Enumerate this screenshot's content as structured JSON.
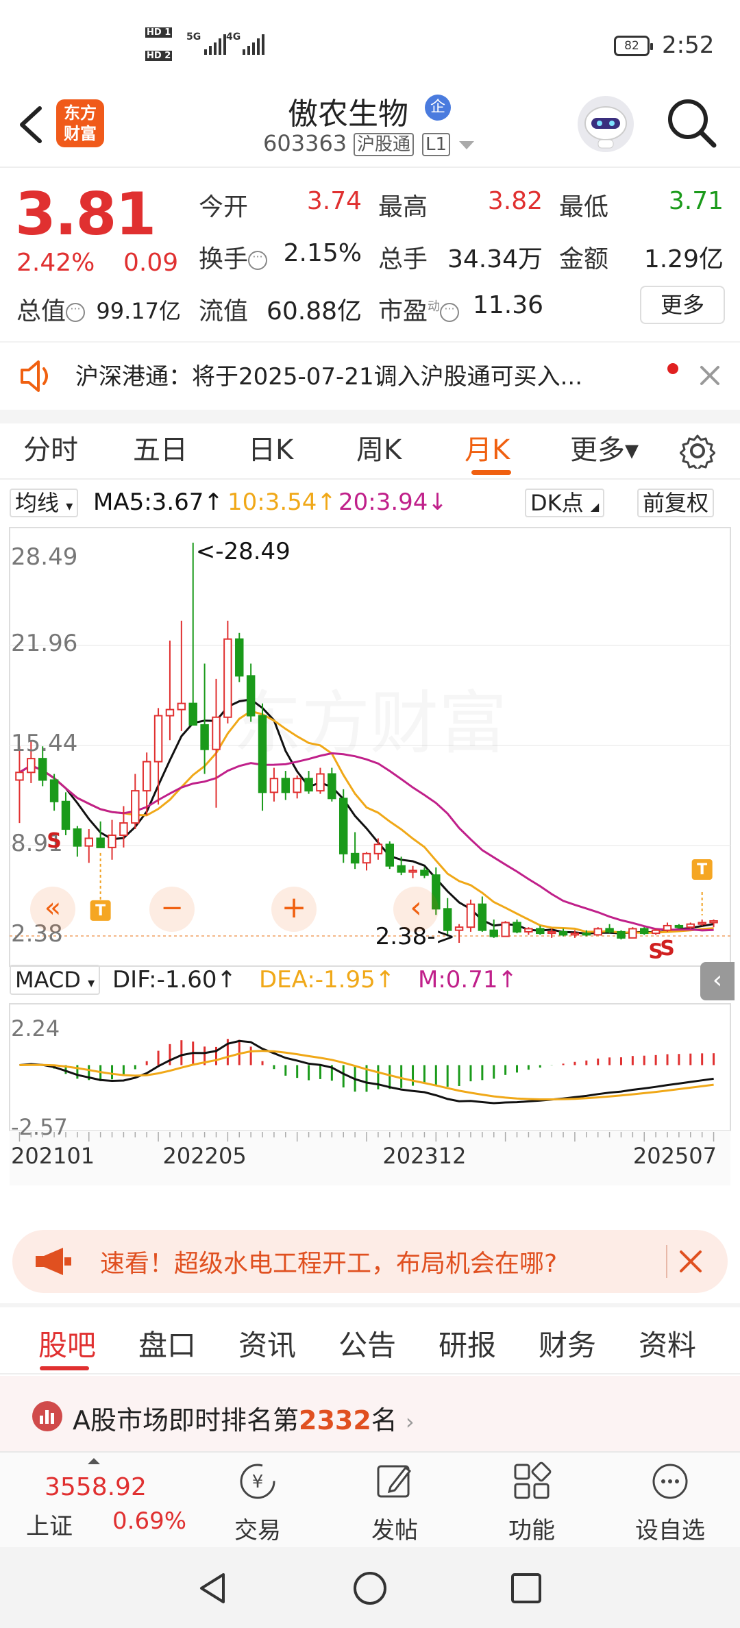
{
  "status_bar": {
    "sim1": "HD 1",
    "sim2": "HD 2",
    "net1": "5G",
    "net2": "4G",
    "battery": "82",
    "time": "2:52"
  },
  "header": {
    "logo_line1": "东方",
    "logo_line2": "财富",
    "stock_name": "傲农生物",
    "badge": "企",
    "code": "603363",
    "tag_connect": "沪股通",
    "tag_level": "L1"
  },
  "quote": {
    "price": "3.81",
    "change_pct": "2.42%",
    "change_val": "0.09",
    "open_label": "今开",
    "open": "3.74",
    "high_label": "最高",
    "high": "3.82",
    "low_label": "最低",
    "low": "3.71",
    "turnover_label": "换手",
    "turnover": "2.15%",
    "volume_label": "总手",
    "volume": "34.34万",
    "amount_label": "金额",
    "amount": "1.29亿",
    "mktcap_label": "总值",
    "mktcap": "99.17亿",
    "float_label": "流值",
    "float": "60.88亿",
    "pe_label": "市盈",
    "pe_sup": "动",
    "pe": "11.36",
    "more": "更多"
  },
  "notice": {
    "text": "沪深港通：将于2025-07-21调入沪股通可买入..."
  },
  "tabs": [
    "分时",
    "五日",
    "日K",
    "周K",
    "月K",
    "更多▾"
  ],
  "active_tab": "月K",
  "indicator_bar": {
    "ma_select": "均线",
    "ma5": "MA5:3.67↑",
    "ma10": "10:3.54↑",
    "ma20": "20:3.94↓",
    "dk": "DK点",
    "adjust": "前复权"
  },
  "colors": {
    "up": "#e03030",
    "down": "#1a9a1a",
    "ma5": "#111111",
    "ma10": "#f0a818",
    "ma20": "#c0208a",
    "accent": "#f06010"
  },
  "chart_data": {
    "type": "candlestick",
    "period": "monthly",
    "y_ticks": [
      "28.49",
      "21.96",
      "15.44",
      "8.91",
      "2.38"
    ],
    "ylim": [
      2.38,
      28.49
    ],
    "max_label": "<-28.49",
    "min_label": "2.38->",
    "x_ticks": [
      "202101",
      "202205",
      "202312",
      "202507"
    ],
    "candles": [
      [
        13.0,
        15.2,
        10.2,
        13.5
      ],
      [
        13.5,
        15.6,
        12.8,
        14.4
      ],
      [
        14.4,
        15.2,
        12.6,
        13.0
      ],
      [
        13.0,
        13.4,
        11.0,
        11.6
      ],
      [
        11.6,
        12.2,
        9.4,
        9.8
      ],
      [
        9.8,
        10.0,
        8.0,
        8.7
      ],
      [
        8.7,
        9.8,
        7.6,
        9.2
      ],
      [
        9.2,
        10.3,
        8.6,
        8.6
      ],
      [
        8.6,
        10.4,
        7.8,
        9.4
      ],
      [
        9.4,
        11.3,
        8.6,
        10.2
      ],
      [
        10.2,
        13.4,
        9.8,
        12.3
      ],
      [
        12.3,
        14.8,
        10.7,
        14.2
      ],
      [
        14.2,
        17.7,
        11.4,
        17.2
      ],
      [
        17.2,
        22.1,
        15.6,
        17.6
      ],
      [
        17.6,
        23.4,
        16.2,
        18.0
      ],
      [
        18.0,
        28.49,
        16.6,
        16.6
      ],
      [
        16.6,
        20.6,
        13.4,
        15.0
      ],
      [
        15.0,
        19.6,
        11.2,
        17.1
      ],
      [
        17.1,
        23.4,
        16.7,
        22.2
      ],
      [
        22.2,
        22.6,
        19.4,
        19.8
      ],
      [
        19.8,
        20.6,
        16.8,
        17.2
      ],
      [
        17.2,
        18.0,
        11.0,
        12.2
      ],
      [
        12.2,
        13.8,
        11.6,
        13.1
      ],
      [
        13.1,
        13.6,
        11.7,
        12.2
      ],
      [
        12.2,
        13.3,
        11.8,
        13.1
      ],
      [
        13.1,
        13.6,
        12.1,
        12.3
      ],
      [
        12.3,
        13.8,
        12.1,
        13.4
      ],
      [
        13.4,
        13.8,
        11.6,
        11.8
      ],
      [
        11.8,
        12.4,
        7.6,
        8.2
      ],
      [
        8.2,
        9.6,
        7.2,
        7.6
      ],
      [
        7.6,
        8.3,
        7.1,
        8.2
      ],
      [
        8.2,
        9.2,
        7.8,
        8.8
      ],
      [
        8.8,
        9.0,
        7.2,
        7.4
      ],
      [
        7.4,
        8.0,
        6.8,
        7.0
      ],
      [
        7.0,
        7.4,
        6.6,
        7.1
      ],
      [
        7.1,
        7.3,
        6.6,
        6.8
      ],
      [
        6.8,
        7.3,
        4.2,
        4.6
      ],
      [
        4.6,
        5.3,
        2.8,
        3.2
      ],
      [
        3.2,
        3.6,
        2.38,
        3.4
      ],
      [
        3.4,
        5.2,
        3.1,
        4.9
      ],
      [
        4.9,
        5.4,
        3.1,
        3.2
      ],
      [
        3.2,
        3.9,
        2.7,
        2.8
      ],
      [
        2.8,
        3.8,
        2.8,
        3.7
      ],
      [
        3.7,
        3.9,
        3.0,
        3.1
      ],
      [
        3.1,
        3.4,
        2.9,
        3.3
      ],
      [
        3.3,
        3.5,
        2.9,
        3.0
      ],
      [
        3.0,
        3.3,
        2.7,
        3.1
      ],
      [
        3.1,
        3.3,
        2.8,
        2.9
      ],
      [
        2.9,
        3.2,
        2.7,
        3.0
      ],
      [
        3.0,
        3.2,
        2.8,
        2.9
      ],
      [
        2.9,
        3.4,
        2.9,
        3.3
      ],
      [
        3.3,
        3.6,
        3.0,
        3.1
      ],
      [
        3.1,
        3.2,
        2.6,
        2.7
      ],
      [
        2.7,
        3.4,
        2.7,
        3.3
      ],
      [
        3.3,
        3.4,
        2.9,
        3.0
      ],
      [
        3.0,
        3.3,
        2.9,
        3.2
      ],
      [
        3.2,
        3.7,
        3.1,
        3.5
      ],
      [
        3.5,
        3.6,
        3.3,
        3.4
      ],
      [
        3.4,
        3.7,
        3.3,
        3.6
      ],
      [
        3.6,
        3.9,
        3.5,
        3.7
      ],
      [
        3.7,
        3.9,
        3.4,
        3.81
      ]
    ],
    "signals": [
      "T",
      "S",
      "S",
      "S",
      "T"
    ],
    "macd": {
      "label": "MACD",
      "dif": "DIF:-1.60↑",
      "dea": "DEA:-1.95↑",
      "m": "M:0.71↑",
      "y_ticks": [
        "2.24",
        "-2.57"
      ],
      "ylim": [
        -2.57,
        2.24
      ]
    }
  },
  "chart_controls": {
    "zoom_out": "−",
    "zoom_in": "+",
    "scroll_left": "«",
    "prev": "‹"
  },
  "promo": {
    "text": "速看！超级水电工程开工，布局机会在哪?"
  },
  "subtabs": [
    "股吧",
    "盘口",
    "资讯",
    "公告",
    "研报",
    "财务",
    "资料"
  ],
  "rank": {
    "prefix": "A股市场即时排名第",
    "num": "2332",
    "suffix": "名"
  },
  "bottom_nav": {
    "index_value": "3558.92",
    "index_name": "上证",
    "index_pct": "0.69%",
    "items": [
      "交易",
      "发帖",
      "功能",
      "设自选"
    ]
  }
}
